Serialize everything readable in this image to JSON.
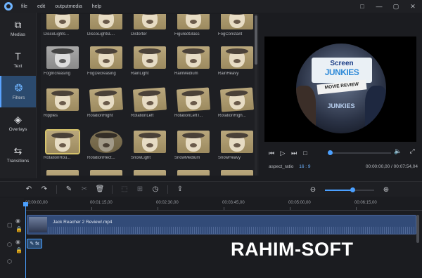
{
  "menu": [
    "file",
    "edit",
    "outputmedia",
    "help"
  ],
  "window_controls": [
    "□",
    "—",
    "▢",
    "✕"
  ],
  "nav": [
    {
      "icon": "media-icon",
      "glyph": "⧉",
      "label": "Medias"
    },
    {
      "icon": "text-icon",
      "glyph": "T",
      "label": "Text"
    },
    {
      "icon": "filters-icon",
      "glyph": "❂",
      "label": "Filters"
    },
    {
      "icon": "overlays-icon",
      "glyph": "◈",
      "label": "Overlays"
    },
    {
      "icon": "transitions-icon",
      "glyph": "⇆",
      "label": "Transitions"
    }
  ],
  "filters": [
    "DiscoLights...",
    "DiscoLightsL...",
    "Distorter",
    "FiguredGlass",
    "FogConstant",
    "FogIncreasing",
    "FogDecreasing",
    "RainLight",
    "RainMedium",
    "RainHeavy",
    "Ripples",
    "RotationRight",
    "RotationLeft",
    "RotationLeftT...",
    "RotationRigh...",
    "RotationRou...",
    "RotationRect...",
    "SnowLight",
    "SnowMedium",
    "SnowHeavy"
  ],
  "selected_filter": "RotationRou...",
  "preview": {
    "banner_top": "Screen",
    "banner_mid": "JUNKIES",
    "ribbon": "MOVIE REVIEW",
    "bottom_logo": "JUNKIES"
  },
  "player": {
    "controls": [
      "⏮",
      "▷",
      "⏭",
      "□"
    ],
    "right_controls": [
      "🔈",
      "⤢"
    ],
    "progress_fraction": 0.03,
    "aspect_ratio_label": "aspect_ratio",
    "aspect_ratio_value": "16 : 9",
    "time": "00:00:00,00 / 00:07:54,04"
  },
  "toolbar": {
    "undo": "↶",
    "redo": "↷",
    "edit": "✎",
    "cut": "✂",
    "delete": "🗑",
    "crop": "⬚",
    "split": "⊞",
    "speed": "◷",
    "export": "⇪",
    "zoom_out": "⊖",
    "zoom_in": "⊕",
    "zoom_fraction": 0.55
  },
  "ruler": [
    "00:00:00,00",
    "00:01:15,00",
    "00:02:30,00",
    "00:03:45,00",
    "00:05:00,00",
    "00:06:15,00"
  ],
  "clip": {
    "label": "Jack Reacher 2 Review!.mp4"
  },
  "fx_chip": {
    "a": "✎",
    "b": "fx"
  },
  "watermark": "RAHIM-SOFT"
}
